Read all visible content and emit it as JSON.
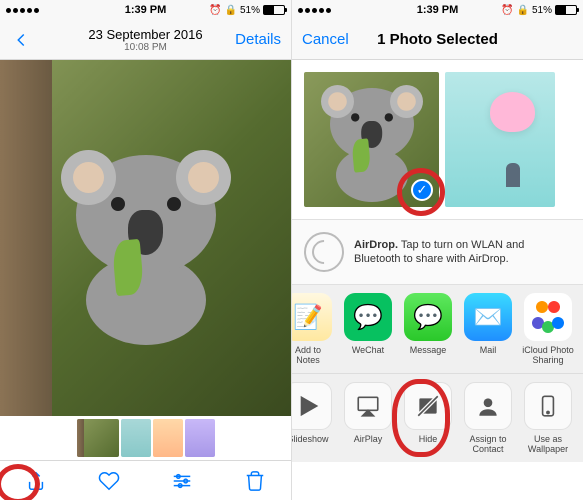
{
  "status": {
    "time": "1:39 PM",
    "battery_pct": "51%",
    "no_sim": ""
  },
  "left": {
    "date": "23 September 2016",
    "time": "10:08 PM",
    "details": "Details"
  },
  "right": {
    "cancel": "Cancel",
    "title": "1 Photo Selected",
    "airdrop_bold": "AirDrop.",
    "airdrop_text": " Tap to turn on WLAN and Bluetooth to share with AirDrop.",
    "apps": [
      {
        "label": "Add to Notes"
      },
      {
        "label": "WeChat"
      },
      {
        "label": "Message"
      },
      {
        "label": "Mail"
      },
      {
        "label": "iCloud Photo Sharing"
      }
    ],
    "actions": [
      {
        "label": "Slideshow"
      },
      {
        "label": "AirPlay"
      },
      {
        "label": "Hide"
      },
      {
        "label": "Assign to Contact"
      },
      {
        "label": "Use as Wallpaper"
      }
    ]
  }
}
